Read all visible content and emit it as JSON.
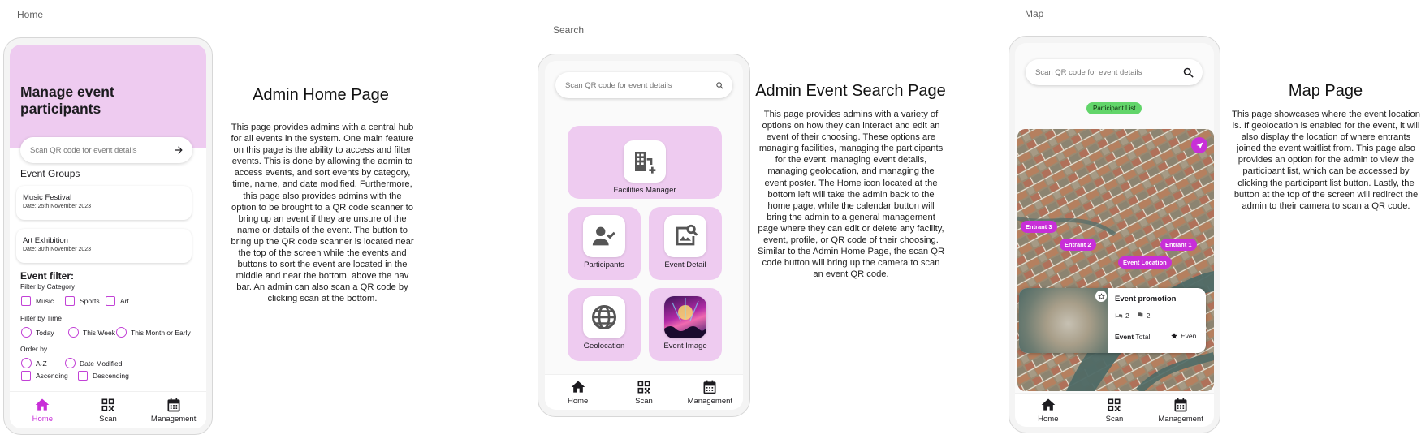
{
  "frames": {
    "home": "Home",
    "search": "Search",
    "map": "Map"
  },
  "nav": {
    "home": "Home",
    "scan": "Scan",
    "management": "Management"
  },
  "home": {
    "title": "Manage event participants",
    "search_placeholder": "Scan QR code for event details",
    "groups_heading": "Event Groups",
    "events": [
      {
        "name": "Music Festival",
        "date": "Date: 25th November 2023"
      },
      {
        "name": "Art Exhibition",
        "date": "Date: 30th November 2023"
      }
    ],
    "filter_heading": "Event filter:",
    "filter_category_label": "Filter by Category",
    "categories": [
      "Music",
      "Sports",
      "Art"
    ],
    "filter_time_label": "Filter by Time",
    "times": [
      "Today",
      "This Week",
      "This Month or Early"
    ],
    "order_label": "Order by",
    "orders": [
      "A-Z",
      "Date Modified"
    ],
    "directions": [
      "Ascending",
      "Descending"
    ]
  },
  "home_desc": {
    "title": "Admin Home Page",
    "body": "This page provides admins with a central hub for all events in the system. One main feature on this page is the ability to access and filter events. This is done by allowing the admin to access events, and sort events by category, time, name, and date modified. Furthermore, this page also provides admins with the option to be brought to a QR code scanner to bring up an event if they are unsure of the name or details of the event. The button to bring up the QR code scanner is located near the top of the screen while the events and buttons to sort the event are located in the middle and near the bottom, above the nav bar. An admin can also scan a QR code by clicking scan at the bottom."
  },
  "search": {
    "search_placeholder": "Scan QR code for event details",
    "tiles": {
      "facilities": "Facilities Manager",
      "participants": "Participants",
      "event_detail": "Event Detail",
      "geolocation": "Geolocation",
      "event_image": "Event Image"
    }
  },
  "search_desc": {
    "title": "Admin Event Search Page",
    "body": "This page provides admins with a variety of options on how they can interact and edit an event of their choosing. These options are managing facilities, managing the participants for the event, managing event details, managing geolocation, and managing the event poster. The Home icon located at the bottom left will take the admin back to the home page, while the calendar button will bring the admin to a general management page where they can edit or delete any facility, event, profile, or QR code of their choosing. Similar to the Admin Home Page, the scan QR code button will bring up the camera to scan an event QR code."
  },
  "map": {
    "search_placeholder": "Scan QR code for event details",
    "chip": "Participant List",
    "pins": {
      "entrant3": "Entrant 3",
      "entrant2": "Entrant 2",
      "entrant1": "Entrant 1",
      "event_location": "Event Location"
    },
    "promo": {
      "title": "Event promotion",
      "stat1": "2",
      "stat2": "2",
      "label_bold": "Event",
      "label_rest": "Total",
      "star_label": "Even"
    }
  },
  "map_desc": {
    "title": "Map Page",
    "body": "This page showcases where the event location is. If geolocation is enabled for the event, it will also display the location of where entrants joined the event waitlist from. This page also provides an option for the admin to view the participant list, which can be accessed by clicking the participant list button. Lastly, the button at the top of the screen will redirect the admin to their camera to scan a QR code."
  },
  "colors": {
    "accent": "#c82fd8",
    "tile": "#eecbf0",
    "chip": "#62d56a"
  }
}
